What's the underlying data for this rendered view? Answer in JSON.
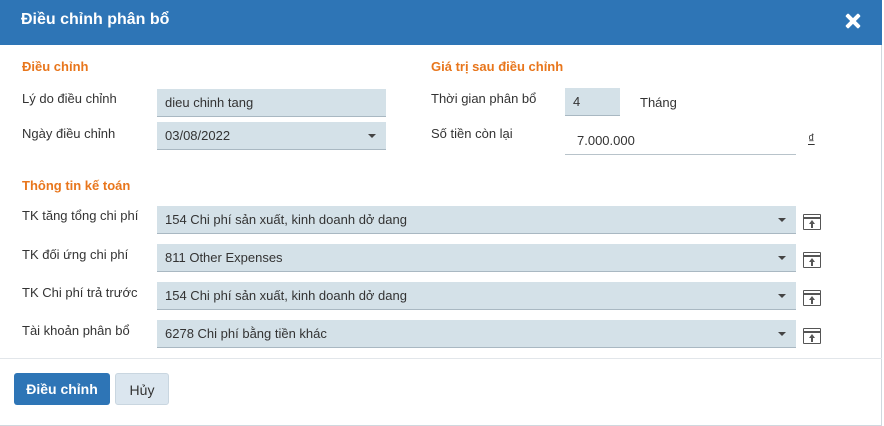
{
  "dialog": {
    "title": "Điều chỉnh phân bổ"
  },
  "adjust": {
    "section": "Điều chỉnh",
    "reason_label": "Lý do điều chỉnh",
    "reason_value": "dieu chinh tang",
    "date_label": "Ngày điều chỉnh",
    "date_value": "03/08/2022"
  },
  "after": {
    "section": "Giá trị sau điều chỉnh",
    "period_label": "Thời gian phân bổ",
    "period_value": "4",
    "period_unit": "Tháng",
    "remaining_label": "Số tiền còn lại",
    "remaining_value": "7.000.000",
    "currency": "₫"
  },
  "accounting": {
    "section": "Thông tin kế toán",
    "rows": [
      {
        "label": "TK tăng tổng chi phí",
        "value": "154 Chi phí sản xuất, kinh doanh dở dang"
      },
      {
        "label": "TK đối ứng chi phí",
        "value": "811 Other Expenses"
      },
      {
        "label": "TK Chi phí trả trước",
        "value": "154 Chi phí sản xuất, kinh doanh dở dang"
      },
      {
        "label": "Tài khoản phân bổ",
        "value": "6278 Chi phí bằng tiền khác"
      }
    ]
  },
  "footer": {
    "confirm_label": "Điều chỉnh",
    "cancel_label": "Hủy"
  },
  "colors": {
    "header": "#2e75b6",
    "section": "#e8761c",
    "field_bg": "#d4e1e8"
  },
  "icons": {
    "close": "close-icon",
    "picker": "open-picker-icon",
    "dropdown": "chevron-down-icon"
  }
}
